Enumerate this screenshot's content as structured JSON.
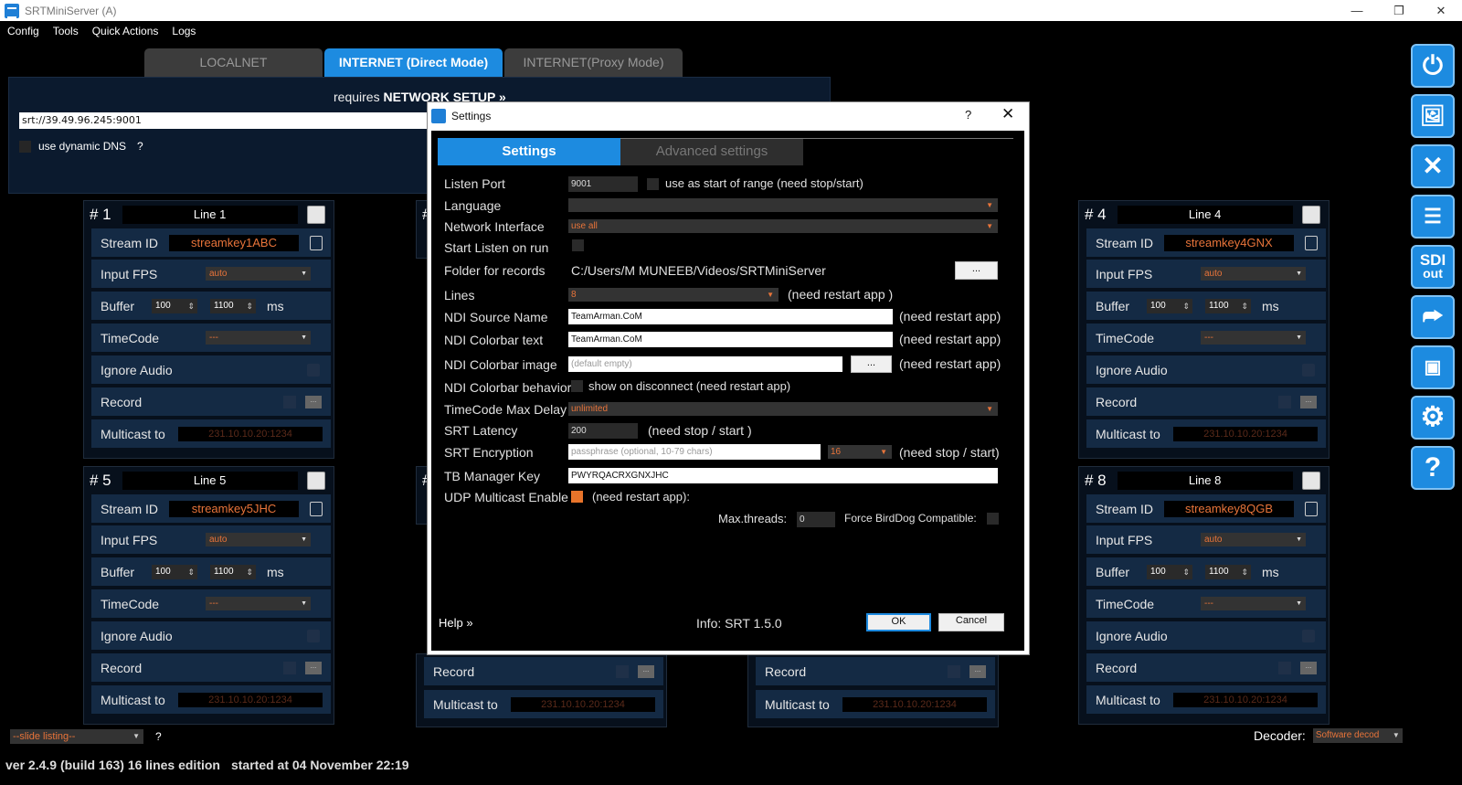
{
  "window": {
    "title": "SRTMiniServer (A)",
    "minimize": "—",
    "restore": "❐",
    "close": "✕"
  },
  "menu": [
    "Config",
    "Tools",
    "Quick Actions",
    "Logs"
  ],
  "tabs": [
    {
      "label": "LOCALNET"
    },
    {
      "label": "INTERNET (Direct Mode)"
    },
    {
      "label": "INTERNET(Proxy Mode)"
    }
  ],
  "network": {
    "requires": "requires",
    "setup": "NETWORK SETUP »",
    "url": "srt://39.49.96.245:9001",
    "dns_label": "use dynamic DNS",
    "dns_help": "?"
  },
  "line_labels": {
    "stream_id": "Stream ID",
    "input_fps": "Input FPS",
    "buffer": "Buffer",
    "timecode": "TimeCode",
    "ignore_audio": "Ignore Audio",
    "record": "Record",
    "multicast": "Multicast to",
    "ms": "ms",
    "fps_value": "auto",
    "tc_value": "---",
    "buf_min": "100",
    "buf_max": "1100",
    "mc_value": "231.10.10.20:1234",
    "rec_btn": "..."
  },
  "lines": [
    {
      "num": "# 1",
      "name": "Line 1",
      "stream": "streamkey1ABC"
    },
    {
      "num": "# 4",
      "name": "Line 4",
      "stream": "streamkey4GNX"
    },
    {
      "num": "# 5",
      "name": "Line 5",
      "stream": "streamkey5JHC"
    },
    {
      "num": "# 8",
      "name": "Line 8",
      "stream": "streamkey8QGB"
    }
  ],
  "partial": {
    "hash": "#",
    "record": "Record",
    "multicast": "Multicast to",
    "mc_value": "231.10.10.20:1234"
  },
  "sidebar": {
    "sdi_top": "SDI",
    "sdi_bottom": "out"
  },
  "bottom": {
    "slide": "--slide listing--",
    "slide_help": "?",
    "decoder_label": "Decoder:",
    "decoder_value": "Software decod",
    "version": "ver 2.4.9 (build 163) 16 lines edition",
    "started": "started at 04 November 22:19"
  },
  "dialog": {
    "title": "Settings",
    "help_q": "?",
    "close": "✕",
    "tab_settings": "Settings",
    "tab_advanced": "Advanced settings",
    "listen_port_label": "Listen Port",
    "listen_port": "9001",
    "range_label": "use as start of range (need stop/start)",
    "language_label": "Language",
    "netif_label": "Network Interface",
    "netif_value": "use all",
    "start_listen_label": "Start Listen on run",
    "folder_label": "Folder for records",
    "folder_value": "C:/Users/M MUNEEB/Videos/SRTMiniServer",
    "folder_btn": "...",
    "lines_label": "Lines",
    "lines_value": "8",
    "lines_note": "(need restart app )",
    "ndi_source_label": "NDI Source Name",
    "ndi_source": "TeamArman.CoM",
    "restart_note": "(need restart app)",
    "ndi_text_label": "NDI Colorbar text",
    "ndi_text": "TeamArman.CoM",
    "ndi_image_label": "NDI Colorbar image",
    "ndi_image_ph": "(default empty)",
    "ndi_image_btn": "...",
    "ndi_behavior_label": "NDI Colorbar behavior",
    "ndi_behavior_note": "show on disconnect (need restart app)",
    "tc_delay_label": "TimeCode Max Delay",
    "tc_delay": "unlimited",
    "latency_label": "SRT Latency",
    "latency": "200",
    "latency_note": "(need stop / start )",
    "enc_label": "SRT Encryption",
    "enc_ph": "passphrase (optional, 10-79 chars)",
    "enc_len": "16",
    "enc_note": "(need stop / start)",
    "tb_label": "TB Manager Key",
    "tb_value": "PWYRQACRXGNXJHC",
    "udp_label": "UDP Multicast Enable",
    "udp_note": "(need restart app):",
    "threads_label": "Max.threads:",
    "threads": "0",
    "birddog_label": "Force BirdDog Compatible:",
    "help": "Help »",
    "info": "Info: SRT 1.5.0",
    "ok": "OK",
    "cancel": "Cancel"
  }
}
